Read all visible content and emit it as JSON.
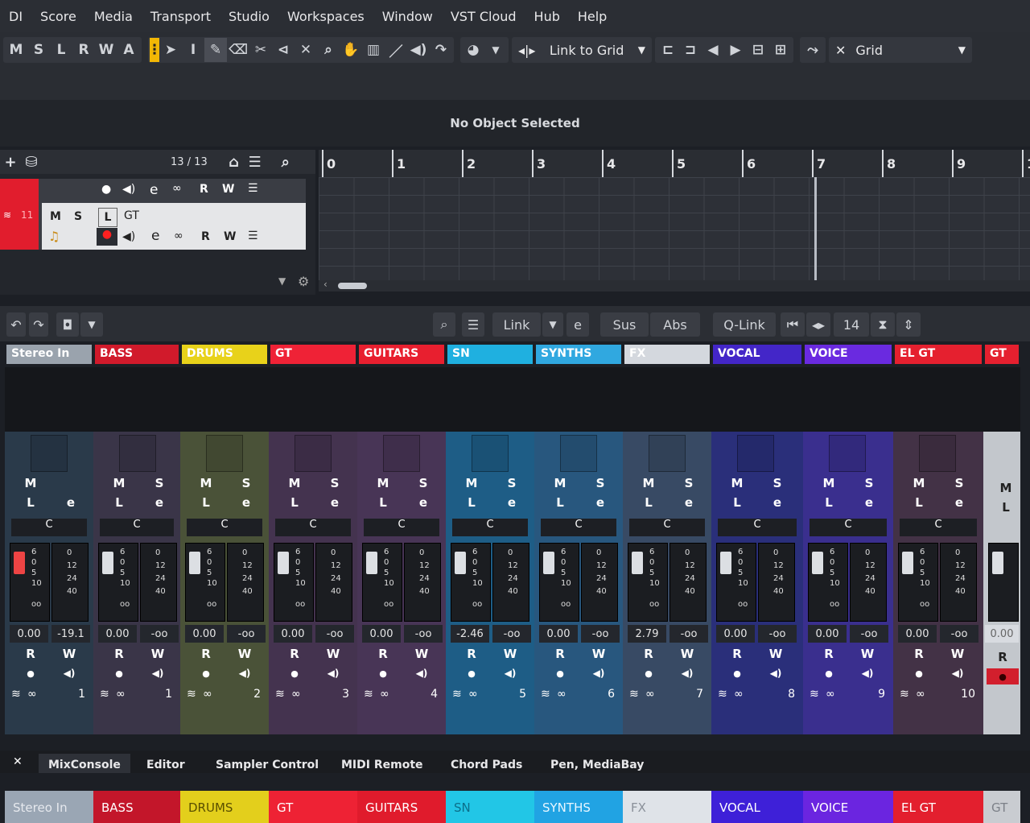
{
  "menu": [
    "DI",
    "Score",
    "Media",
    "Transport",
    "Studio",
    "Workspaces",
    "Window",
    "VST Cloud",
    "Hub",
    "Help"
  ],
  "toolbar": {
    "modes": [
      "M",
      "S",
      "L",
      "R",
      "W",
      "A"
    ],
    "snap_label": "Link to Grid",
    "grid_label": "Grid"
  },
  "info_line": "No Object Selected",
  "tracklist": {
    "count": "13 / 13",
    "track_number": "11",
    "track_name": "GT",
    "buttons": [
      "M",
      "S",
      "L",
      "R",
      "W"
    ]
  },
  "ruler": [
    "0",
    "1",
    "2",
    "3",
    "4",
    "5",
    "6",
    "7",
    "8",
    "9",
    "1"
  ],
  "mix_toolbar": {
    "link": "Link",
    "sus": "Sus",
    "abs": "Abs",
    "qlink": "Q-Link",
    "number": "14"
  },
  "channels": [
    {
      "name": "Stereo In",
      "number": "1",
      "fader": "0.00",
      "meter": "-19.1",
      "foot": "Stereo In",
      "color": "#9aa3ad",
      "body": "#2a3a4a",
      "foot_bg": "#9aa6b4",
      "foot_text": "#e6e9ee",
      "s": "",
      "e": "e",
      "stereo": true
    },
    {
      "name": "BASS",
      "number": "1",
      "fader": "0.00",
      "meter": "-oo",
      "foot": "BASS",
      "color": "#d11a2b",
      "body": "#3a3548",
      "foot_bg": "#c3162a",
      "foot_text": "#ffffff",
      "s": "S",
      "e": "e"
    },
    {
      "name": "DRUMS",
      "number": "2",
      "fader": "0.00",
      "meter": "-oo",
      "foot": "DRUMS",
      "color": "#e8d21a",
      "body": "#4a5238",
      "foot_bg": "#e3cf1c",
      "foot_text": "#5a4f00",
      "s": "S",
      "e": "e"
    },
    {
      "name": "GT",
      "number": "3",
      "fader": "0.00",
      "meter": "-oo",
      "foot": "GT",
      "color": "#ef2236",
      "body": "#44334f",
      "foot_bg": "#ee2234",
      "foot_text": "#ffffff",
      "s": "S",
      "e": "e"
    },
    {
      "name": "GUITARS",
      "number": "4",
      "fader": "0.00",
      "meter": "-oo",
      "foot": "GUITARS",
      "color": "#e81f2f",
      "body": "#483556",
      "foot_bg": "#e01b2c",
      "foot_text": "#ffffff",
      "s": "S",
      "e": "e"
    },
    {
      "name": "SN",
      "number": "5",
      "fader": "-2.46",
      "meter": "-oo",
      "foot": "SN",
      "color": "#1fb0e0",
      "body": "#1e5d86",
      "foot_bg": "#22c6e6",
      "foot_text": "#0c6f8a",
      "s": "S",
      "e": "e"
    },
    {
      "name": "SYNTHS",
      "number": "6",
      "fader": "0.00",
      "meter": "-oo",
      "foot": "SYNTHS",
      "color": "#30a8e0",
      "body": "#28577e",
      "foot_bg": "#21a3e3",
      "foot_text": "#e8f6ff",
      "s": "S",
      "e": "e"
    },
    {
      "name": "FX",
      "number": "7",
      "fader": "2.79",
      "meter": "-oo",
      "foot": "FX",
      "color": "#d4d8de",
      "body": "#384a64",
      "foot_bg": "#dfe3e8",
      "foot_text": "#8a9099",
      "s": "S",
      "e": "e"
    },
    {
      "name": "VOCAL",
      "number": "8",
      "fader": "0.00",
      "meter": "-oo",
      "foot": "VOCAL",
      "color": "#4326c8",
      "body": "#2a2f7a",
      "foot_bg": "#3e20d8",
      "foot_text": "#ffffff",
      "s": "S",
      "e": "e"
    },
    {
      "name": "VOICE",
      "number": "9",
      "fader": "0.00",
      "meter": "-oo",
      "foot": "VOICE",
      "color": "#6a2ae0",
      "body": "#3a2f8e",
      "foot_bg": "#6b25e0",
      "foot_text": "#ffffff",
      "s": "S",
      "e": "e"
    },
    {
      "name": "EL GT",
      "number": "10",
      "fader": "0.00",
      "meter": "-oo",
      "foot": "EL GT",
      "color": "#e5202f",
      "body": "#433246",
      "foot_bg": "#e31f2e",
      "foot_text": "#ffffff",
      "s": "S",
      "e": "e"
    },
    {
      "name": "GT",
      "number": "",
      "fader": "0.00",
      "meter": "",
      "foot": "GT",
      "color": "#e5202f",
      "body": "#c3c7cc",
      "foot_bg": "#c9ccd1",
      "foot_text": "#7c8088",
      "s": "",
      "e": "",
      "partial": true
    }
  ],
  "scales": {
    "fader": [
      "6",
      "0",
      "5",
      "10",
      "",
      "oo"
    ],
    "meter": [
      "0",
      "12",
      "24",
      "40"
    ]
  },
  "bottom_tabs": [
    "MixConsole",
    "Editor",
    "Sampler Control",
    "MIDI Remote",
    "Chord Pads",
    "Pen, MediaBay"
  ]
}
